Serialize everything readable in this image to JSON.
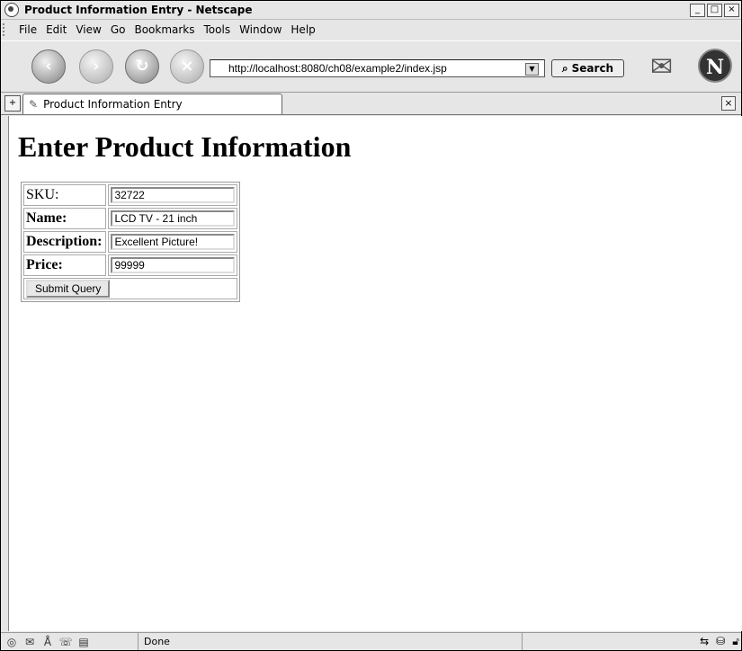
{
  "window": {
    "title": "Product Information Entry - Netscape"
  },
  "menu": [
    "File",
    "Edit",
    "View",
    "Go",
    "Bookmarks",
    "Tools",
    "Window",
    "Help"
  ],
  "nav": {
    "url": "http://localhost:8080/ch08/example2/index.jsp",
    "search_label": "Search"
  },
  "tab": {
    "label": "Product Information Entry"
  },
  "page": {
    "heading": "Enter Product Information",
    "fields": [
      {
        "label": "SKU:",
        "value": "32722"
      },
      {
        "label": "Name:",
        "value": "LCD TV - 21 inch"
      },
      {
        "label": "Description:",
        "value": "Excellent Picture!"
      },
      {
        "label": "Price:",
        "value": "99999"
      }
    ],
    "submit_label": "Submit Query"
  },
  "status": {
    "text": "Done"
  }
}
